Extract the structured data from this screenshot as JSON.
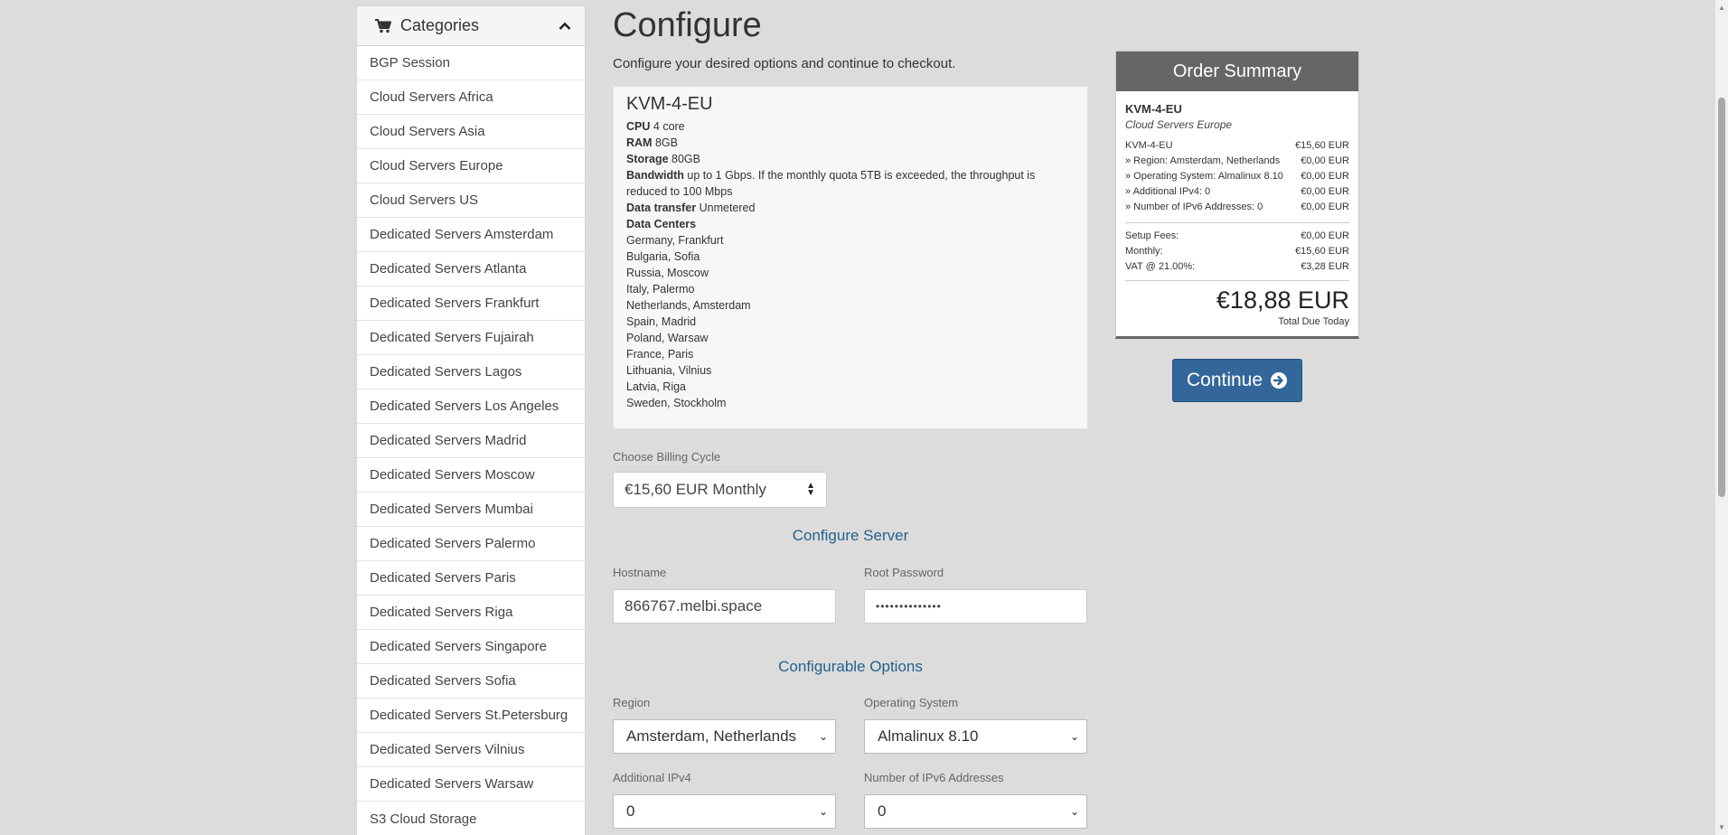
{
  "sidebar": {
    "title": "Categories",
    "items": [
      "BGP Session",
      "Cloud Servers Africa",
      "Cloud Servers Asia",
      "Cloud Servers Europe",
      "Cloud Servers US",
      "Dedicated Servers Amsterdam",
      "Dedicated Servers Atlanta",
      "Dedicated Servers Frankfurt",
      "Dedicated Servers Fujairah",
      "Dedicated Servers Lagos",
      "Dedicated Servers Los Angeles",
      "Dedicated Servers Madrid",
      "Dedicated Servers Moscow",
      "Dedicated Servers Mumbai",
      "Dedicated Servers Palermo",
      "Dedicated Servers Paris",
      "Dedicated Servers Riga",
      "Dedicated Servers Singapore",
      "Dedicated Servers Sofia",
      "Dedicated Servers St.Petersburg",
      "Dedicated Servers Vilnius",
      "Dedicated Servers Warsaw",
      "S3 Cloud Storage"
    ]
  },
  "main": {
    "title": "Configure",
    "subtitle": "Configure your desired options and continue to checkout.",
    "product": {
      "name": "KVM-4-EU",
      "cpu_label": "CPU",
      "cpu_value": "4 core",
      "ram_label": "RAM",
      "ram_value": "8GB",
      "storage_label": "Storage",
      "storage_value": "80GB",
      "bandwidth_label": "Bandwidth",
      "bandwidth_value": "up to 1 Gbps. If the monthly quota 5TB is exceeded, the throughput is reduced to 100 Mbps",
      "transfer_label": "Data transfer",
      "transfer_value": "Unmetered",
      "dc_label": "Data Centers",
      "data_centers": [
        "Germany, Frankfurt",
        "Bulgaria, Sofia",
        "Russia, Moscow",
        "Italy, Palermo",
        "Netherlands, Amsterdam",
        "Spain, Madrid",
        "Poland, Warsaw",
        "France, Paris",
        "Lithuania, Vilnius",
        "Latvia, Riga",
        "Sweden, Stockholm"
      ]
    },
    "billing": {
      "label": "Choose Billing Cycle",
      "value": "€15,60 EUR Monthly"
    },
    "configure_server": {
      "title": "Configure Server",
      "hostname_label": "Hostname",
      "hostname_value": "866767.melbi.space",
      "password_label": "Root Password",
      "password_value": "••••••••••••••"
    },
    "configurable_options": {
      "title": "Configurable Options",
      "region_label": "Region",
      "region_value": "Amsterdam, Netherlands",
      "os_label": "Operating System",
      "os_value": "Almalinux 8.10",
      "ipv4_label": "Additional IPv4",
      "ipv4_value": "0",
      "ipv6_label": "Number of IPv6 Addresses",
      "ipv6_value": "0"
    }
  },
  "summary": {
    "title": "Order Summary",
    "product": "KVM-4-EU",
    "group": "Cloud Servers Europe",
    "lines": [
      {
        "label": "KVM-4-EU",
        "value": "€15,60 EUR"
      },
      {
        "label": "» Region: Amsterdam, Netherlands",
        "value": "€0,00 EUR"
      },
      {
        "label": "» Operating System: Almalinux 8.10",
        "value": "€0,00 EUR"
      },
      {
        "label": "» Additional IPv4: 0",
        "value": "€0,00 EUR"
      },
      {
        "label": "» Number of IPv6 Addresses: 0",
        "value": "€0,00 EUR"
      }
    ],
    "totals": [
      {
        "label": "Setup Fees:",
        "value": "€0,00 EUR"
      },
      {
        "label": "Monthly:",
        "value": "€15,60 EUR"
      },
      {
        "label": "VAT @ 21.00%:",
        "value": "€3,28 EUR"
      }
    ],
    "total": "€18,88 EUR",
    "total_caption": "Total Due Today"
  },
  "continue_label": "Continue",
  "icons": {
    "cart": "shopping-cart-icon",
    "collapse": "chevron-up-icon",
    "continue": "arrow-circle-right-icon"
  },
  "colors": {
    "accent": "#26628c",
    "button": "#33679a",
    "summary_header": "#666666"
  }
}
